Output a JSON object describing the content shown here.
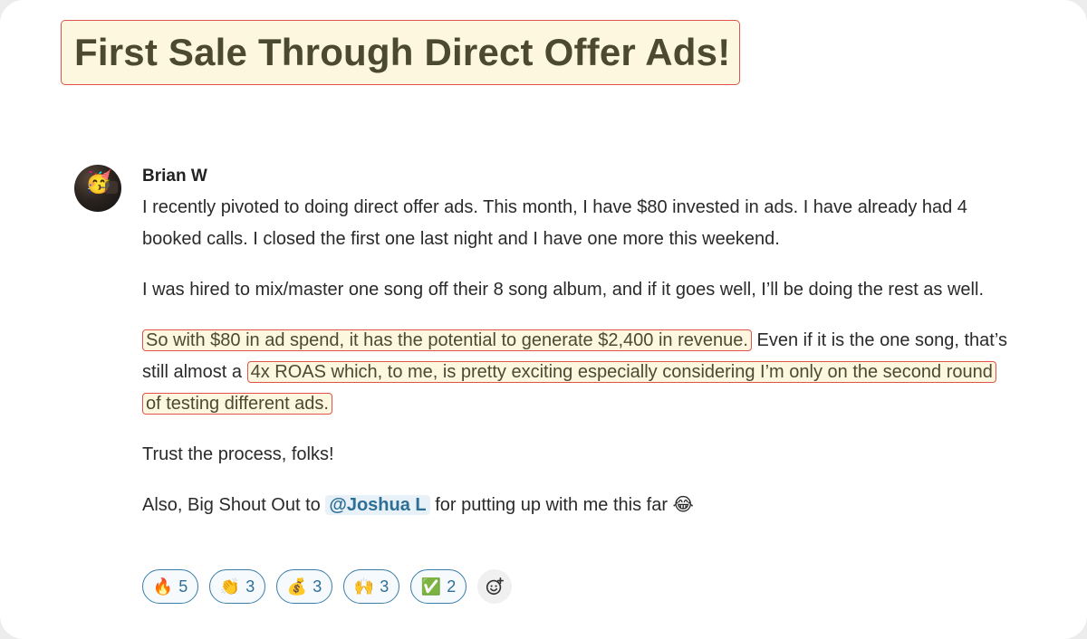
{
  "post": {
    "title": "First Sale Through Direct Offer Ads!",
    "author": "Brian W",
    "avatar_emoji": "🥳",
    "paragraphs": {
      "p1": "I recently pivoted to doing direct offer ads. This month, I have $80 invested in ads. I have already had 4 booked calls. I closed the first one last night and I have one more this weekend.",
      "p2": "I was hired to mix/master one song off their 8 song album, and if it goes well, I’ll be doing the rest as well.",
      "p3_highlight_1": "So with $80 in ad spend, it has the potential to generate $2,400 in revenue.",
      "p3_text": " Even if it is the one song, that’s still almost a",
      "p3_highlight_2": "4x ROAS which, to me, is pretty exciting especially considering I’m only on the second round of testing different ads.",
      "p4": "Trust the process, folks!",
      "p5_before": "Also, Big Shout Out to ",
      "p5_mention": "@Joshua L",
      "p5_after": " for putting up with me this far 😂"
    }
  },
  "reactions": [
    {
      "emoji": "🔥",
      "count": "5",
      "icon": "fire-icon"
    },
    {
      "emoji": "👏",
      "count": "3",
      "icon": "clap-icon"
    },
    {
      "emoji": "💰",
      "count": "3",
      "icon": "money-bag-icon"
    },
    {
      "emoji": "🙌",
      "count": "3",
      "icon": "raised-hands-icon"
    },
    {
      "emoji": "✅",
      "count": "2",
      "icon": "check-mark-icon"
    }
  ],
  "add_reaction_icon": "add-reaction-icon",
  "colors": {
    "highlight_bg": "#fcf7de",
    "highlight_border": "#e0534a",
    "title_text": "#4b4a30",
    "reaction_border": "#3d7fa8",
    "mention_text": "#2e6f95"
  }
}
